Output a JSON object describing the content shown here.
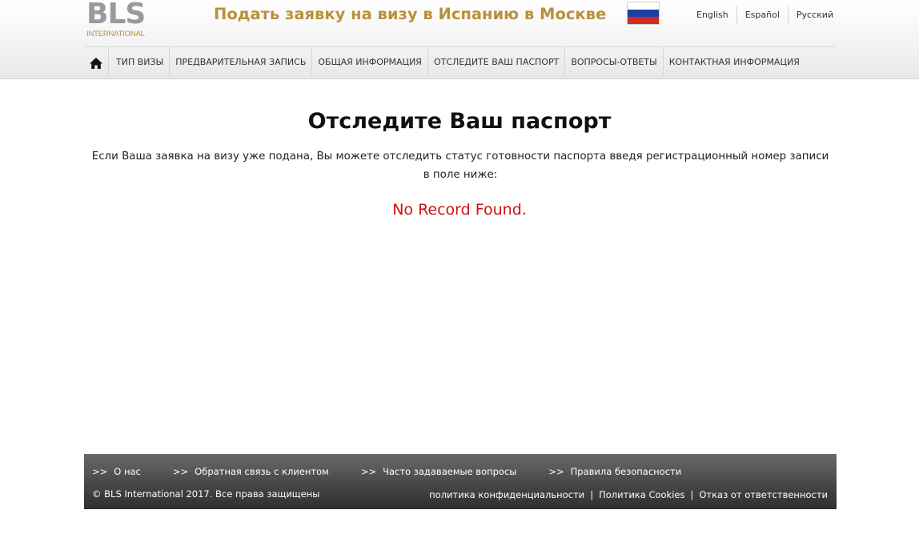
{
  "logo": {
    "letters": "BLS",
    "sub": "INTERNATIONAL"
  },
  "header": {
    "title": "Подать заявку на визу в Испанию в Москве",
    "flag_colors": [
      "#ffffff",
      "#1c3fa8",
      "#d52b1e"
    ],
    "languages": [
      "English",
      "Español",
      "Русский"
    ]
  },
  "nav": {
    "home_icon": "home-icon",
    "items": [
      "ТИП ВИЗЫ",
      "ПРЕДВАРИТЕЛЬНАЯ ЗАПИСЬ",
      "ОБЩАЯ ИНФОРМАЦИЯ",
      "ОТСЛЕДИТЕ ВАШ ПАСПОРТ",
      "ВОПРОСЫ-ОТВЕТЫ",
      "КОНТАКТНАЯ ИНФОРМАЦИЯ"
    ]
  },
  "main": {
    "heading": "Отследите Ваш паспорт",
    "intro_line1": "Если Ваша заявка на визу уже подана, Вы можете отследить статус готовности паспорта введя регистрационный номер записи",
    "intro_line2": "в поле ниже:",
    "status_message": "No Record Found.",
    "status_color": "#cc1111"
  },
  "footer": {
    "link_prefix": ">>",
    "links": [
      "О нас",
      "Обратная связь с клиентом",
      "Часто задаваемые вопросы",
      "Правила безопасности"
    ],
    "copyright": "© BLS International 2017. Все права защищены",
    "policy_separator": "|",
    "policy_links": [
      "политика конфиденциальности",
      "Политика Cookies",
      "Отказ от ответственности"
    ]
  },
  "colors": {
    "brand_gold": "#b8913b",
    "logo_gray": "#9a9a9a",
    "footer_dark": "#3a3a3a"
  }
}
